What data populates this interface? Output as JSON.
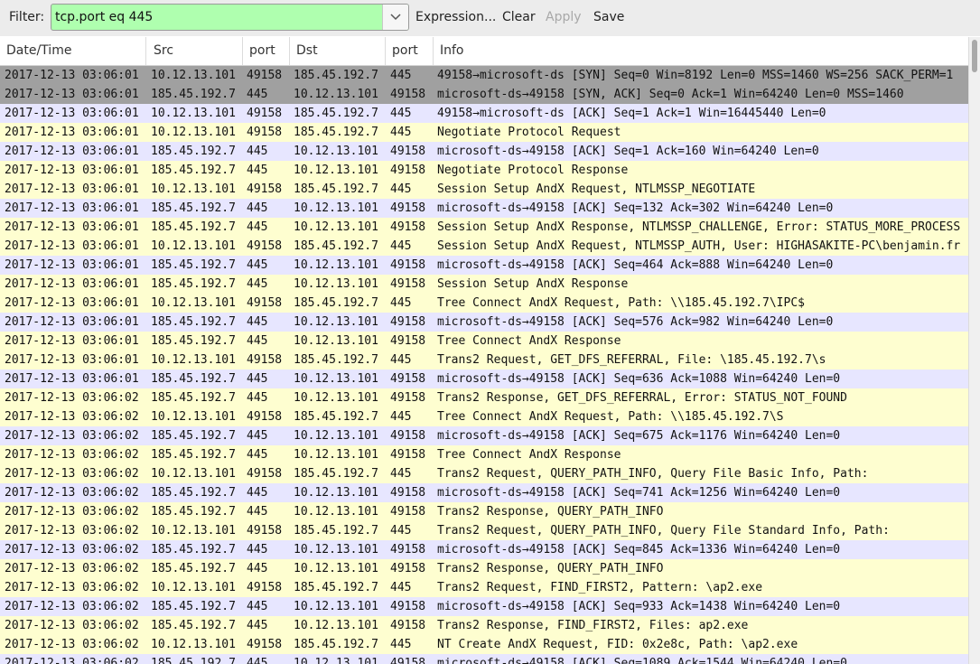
{
  "filter": {
    "label": "Filter:",
    "value": "tcp.port eq 445",
    "expression_label": "Expression...",
    "clear_label": "Clear",
    "apply_label": "Apply",
    "save_label": "Save",
    "valid_color": "#afffaf"
  },
  "columns": [
    "Date/Time",
    "Src",
    "port",
    "Dst",
    "port",
    "Info"
  ],
  "row_colors": {
    "handshake": "#a0a0a0",
    "tcp": "#e7e6ff",
    "smb": "#fefed0"
  },
  "packets": [
    {
      "time": "2017-12-13 03:06:01",
      "src": "10.12.13.101",
      "sport": "49158",
      "dst": "185.45.192.7",
      "dport": "445",
      "info": "49158→microsoft-ds [SYN] Seq=0 Win=8192 Len=0 MSS=1460 WS=256 SACK_PERM=1",
      "color": "handshake"
    },
    {
      "time": "2017-12-13 03:06:01",
      "src": "185.45.192.7",
      "sport": "445",
      "dst": "10.12.13.101",
      "dport": "49158",
      "info": "microsoft-ds→49158 [SYN, ACK] Seq=0 Ack=1 Win=64240 Len=0 MSS=1460",
      "color": "handshake"
    },
    {
      "time": "2017-12-13 03:06:01",
      "src": "10.12.13.101",
      "sport": "49158",
      "dst": "185.45.192.7",
      "dport": "445",
      "info": "49158→microsoft-ds [ACK] Seq=1 Ack=1 Win=16445440 Len=0",
      "color": "tcp"
    },
    {
      "time": "2017-12-13 03:06:01",
      "src": "10.12.13.101",
      "sport": "49158",
      "dst": "185.45.192.7",
      "dport": "445",
      "info": "Negotiate Protocol Request",
      "color": "smb"
    },
    {
      "time": "2017-12-13 03:06:01",
      "src": "185.45.192.7",
      "sport": "445",
      "dst": "10.12.13.101",
      "dport": "49158",
      "info": "microsoft-ds→49158 [ACK] Seq=1 Ack=160 Win=64240 Len=0",
      "color": "tcp"
    },
    {
      "time": "2017-12-13 03:06:01",
      "src": "185.45.192.7",
      "sport": "445",
      "dst": "10.12.13.101",
      "dport": "49158",
      "info": "Negotiate Protocol Response",
      "color": "smb"
    },
    {
      "time": "2017-12-13 03:06:01",
      "src": "10.12.13.101",
      "sport": "49158",
      "dst": "185.45.192.7",
      "dport": "445",
      "info": "Session Setup AndX Request, NTLMSSP_NEGOTIATE",
      "color": "smb"
    },
    {
      "time": "2017-12-13 03:06:01",
      "src": "185.45.192.7",
      "sport": "445",
      "dst": "10.12.13.101",
      "dport": "49158",
      "info": "microsoft-ds→49158 [ACK] Seq=132 Ack=302 Win=64240 Len=0",
      "color": "tcp"
    },
    {
      "time": "2017-12-13 03:06:01",
      "src": "185.45.192.7",
      "sport": "445",
      "dst": "10.12.13.101",
      "dport": "49158",
      "info": "Session Setup AndX Response, NTLMSSP_CHALLENGE, Error: STATUS_MORE_PROCESS",
      "color": "smb"
    },
    {
      "time": "2017-12-13 03:06:01",
      "src": "10.12.13.101",
      "sport": "49158",
      "dst": "185.45.192.7",
      "dport": "445",
      "info": "Session Setup AndX Request, NTLMSSP_AUTH, User: HIGHASAKITE-PC\\benjamin.fr",
      "color": "smb"
    },
    {
      "time": "2017-12-13 03:06:01",
      "src": "185.45.192.7",
      "sport": "445",
      "dst": "10.12.13.101",
      "dport": "49158",
      "info": "microsoft-ds→49158 [ACK] Seq=464 Ack=888 Win=64240 Len=0",
      "color": "tcp"
    },
    {
      "time": "2017-12-13 03:06:01",
      "src": "185.45.192.7",
      "sport": "445",
      "dst": "10.12.13.101",
      "dport": "49158",
      "info": "Session Setup AndX Response",
      "color": "smb"
    },
    {
      "time": "2017-12-13 03:06:01",
      "src": "10.12.13.101",
      "sport": "49158",
      "dst": "185.45.192.7",
      "dport": "445",
      "info": "Tree Connect AndX Request, Path: \\\\185.45.192.7\\IPC$",
      "color": "smb"
    },
    {
      "time": "2017-12-13 03:06:01",
      "src": "185.45.192.7",
      "sport": "445",
      "dst": "10.12.13.101",
      "dport": "49158",
      "info": "microsoft-ds→49158 [ACK] Seq=576 Ack=982 Win=64240 Len=0",
      "color": "tcp"
    },
    {
      "time": "2017-12-13 03:06:01",
      "src": "185.45.192.7",
      "sport": "445",
      "dst": "10.12.13.101",
      "dport": "49158",
      "info": "Tree Connect AndX Response",
      "color": "smb"
    },
    {
      "time": "2017-12-13 03:06:01",
      "src": "10.12.13.101",
      "sport": "49158",
      "dst": "185.45.192.7",
      "dport": "445",
      "info": "Trans2 Request, GET_DFS_REFERRAL, File: \\185.45.192.7\\s",
      "color": "smb"
    },
    {
      "time": "2017-12-13 03:06:01",
      "src": "185.45.192.7",
      "sport": "445",
      "dst": "10.12.13.101",
      "dport": "49158",
      "info": "microsoft-ds→49158 [ACK] Seq=636 Ack=1088 Win=64240 Len=0",
      "color": "tcp"
    },
    {
      "time": "2017-12-13 03:06:02",
      "src": "185.45.192.7",
      "sport": "445",
      "dst": "10.12.13.101",
      "dport": "49158",
      "info": "Trans2 Response, GET_DFS_REFERRAL, Error: STATUS_NOT_FOUND",
      "color": "smb"
    },
    {
      "time": "2017-12-13 03:06:02",
      "src": "10.12.13.101",
      "sport": "49158",
      "dst": "185.45.192.7",
      "dport": "445",
      "info": "Tree Connect AndX Request, Path: \\\\185.45.192.7\\S",
      "color": "smb"
    },
    {
      "time": "2017-12-13 03:06:02",
      "src": "185.45.192.7",
      "sport": "445",
      "dst": "10.12.13.101",
      "dport": "49158",
      "info": "microsoft-ds→49158 [ACK] Seq=675 Ack=1176 Win=64240 Len=0",
      "color": "tcp"
    },
    {
      "time": "2017-12-13 03:06:02",
      "src": "185.45.192.7",
      "sport": "445",
      "dst": "10.12.13.101",
      "dport": "49158",
      "info": "Tree Connect AndX Response",
      "color": "smb"
    },
    {
      "time": "2017-12-13 03:06:02",
      "src": "10.12.13.101",
      "sport": "49158",
      "dst": "185.45.192.7",
      "dport": "445",
      "info": "Trans2 Request, QUERY_PATH_INFO, Query File Basic Info, Path:",
      "color": "smb"
    },
    {
      "time": "2017-12-13 03:06:02",
      "src": "185.45.192.7",
      "sport": "445",
      "dst": "10.12.13.101",
      "dport": "49158",
      "info": "microsoft-ds→49158 [ACK] Seq=741 Ack=1256 Win=64240 Len=0",
      "color": "tcp"
    },
    {
      "time": "2017-12-13 03:06:02",
      "src": "185.45.192.7",
      "sport": "445",
      "dst": "10.12.13.101",
      "dport": "49158",
      "info": "Trans2 Response, QUERY_PATH_INFO",
      "color": "smb"
    },
    {
      "time": "2017-12-13 03:06:02",
      "src": "10.12.13.101",
      "sport": "49158",
      "dst": "185.45.192.7",
      "dport": "445",
      "info": "Trans2 Request, QUERY_PATH_INFO, Query File Standard Info, Path:",
      "color": "smb"
    },
    {
      "time": "2017-12-13 03:06:02",
      "src": "185.45.192.7",
      "sport": "445",
      "dst": "10.12.13.101",
      "dport": "49158",
      "info": "microsoft-ds→49158 [ACK] Seq=845 Ack=1336 Win=64240 Len=0",
      "color": "tcp"
    },
    {
      "time": "2017-12-13 03:06:02",
      "src": "185.45.192.7",
      "sport": "445",
      "dst": "10.12.13.101",
      "dport": "49158",
      "info": "Trans2 Response, QUERY_PATH_INFO",
      "color": "smb"
    },
    {
      "time": "2017-12-13 03:06:02",
      "src": "10.12.13.101",
      "sport": "49158",
      "dst": "185.45.192.7",
      "dport": "445",
      "info": "Trans2 Request, FIND_FIRST2, Pattern: \\ap2.exe",
      "color": "smb"
    },
    {
      "time": "2017-12-13 03:06:02",
      "src": "185.45.192.7",
      "sport": "445",
      "dst": "10.12.13.101",
      "dport": "49158",
      "info": "microsoft-ds→49158 [ACK] Seq=933 Ack=1438 Win=64240 Len=0",
      "color": "tcp"
    },
    {
      "time": "2017-12-13 03:06:02",
      "src": "185.45.192.7",
      "sport": "445",
      "dst": "10.12.13.101",
      "dport": "49158",
      "info": "Trans2 Response, FIND_FIRST2, Files: ap2.exe",
      "color": "smb"
    },
    {
      "time": "2017-12-13 03:06:02",
      "src": "10.12.13.101",
      "sport": "49158",
      "dst": "185.45.192.7",
      "dport": "445",
      "info": "NT Create AndX Request, FID: 0x2e8c, Path: \\ap2.exe",
      "color": "smb"
    },
    {
      "time": "2017-12-13 03:06:02",
      "src": "185.45.192.7",
      "sport": "445",
      "dst": "10.12.13.101",
      "dport": "49158",
      "info": "microsoft-ds→49158 [ACK] Seq=1089 Ack=1544 Win=64240 Len=0",
      "color": "tcp"
    }
  ]
}
